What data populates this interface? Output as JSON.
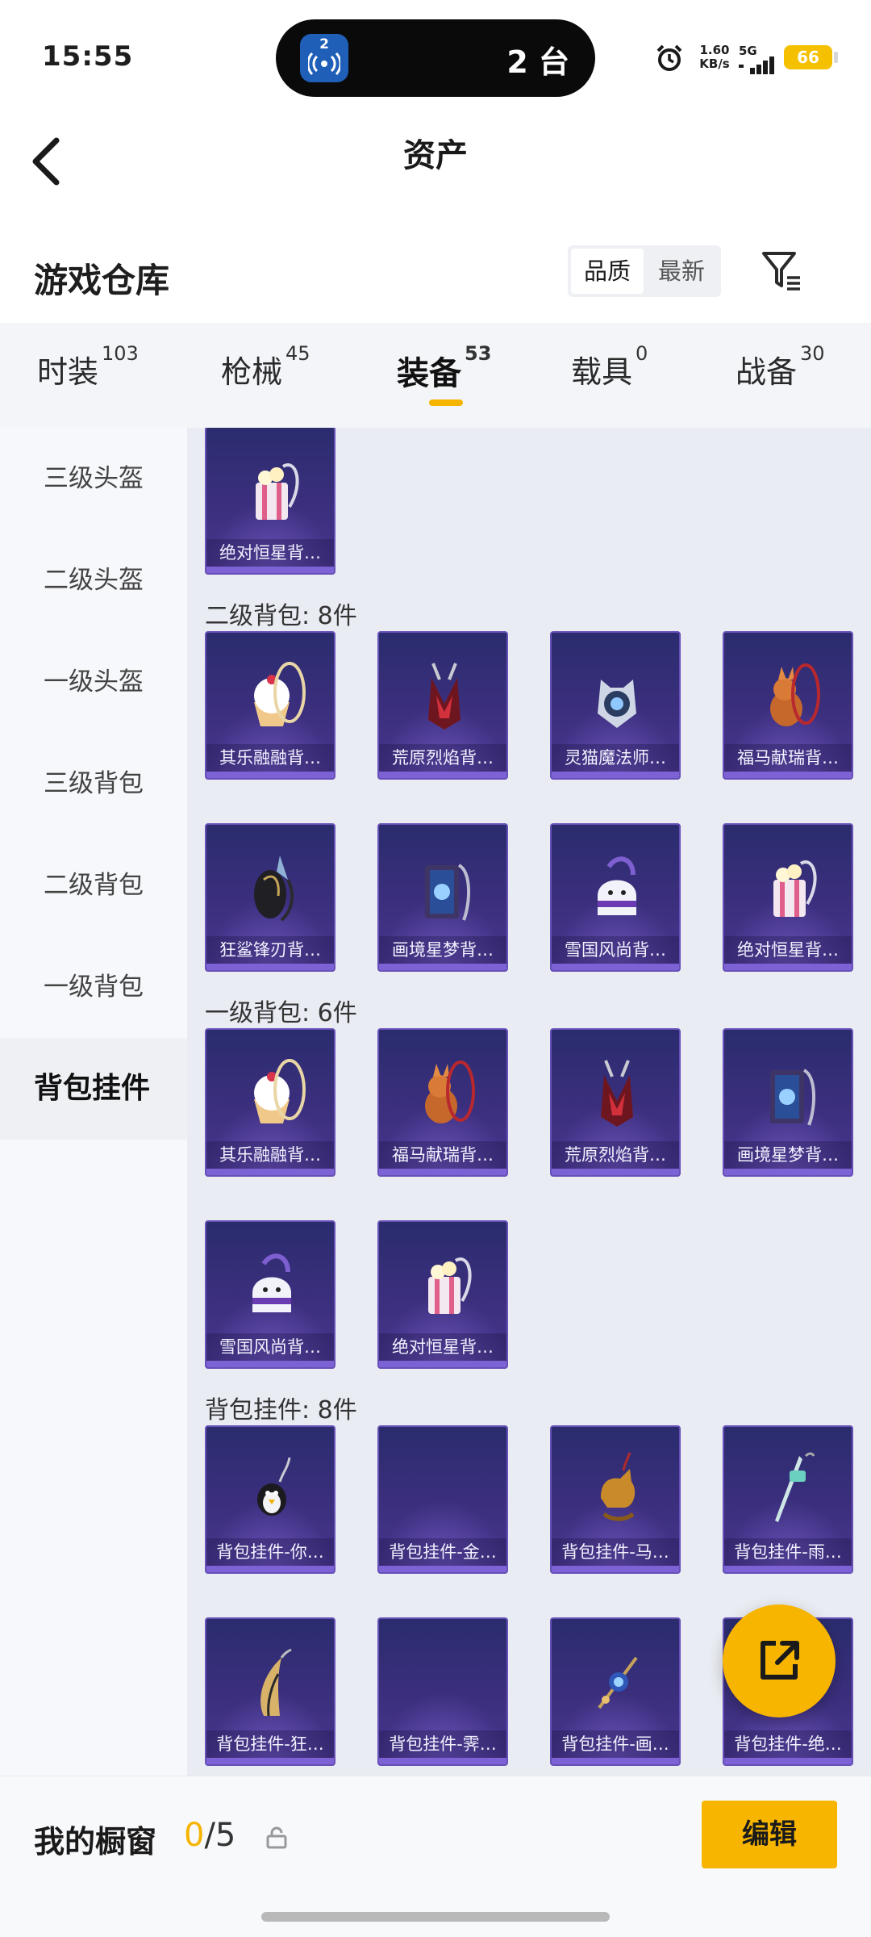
{
  "status": {
    "time": "15:55",
    "island_badge": "2",
    "island_text": "2 台",
    "net_speed_value": "1.60",
    "net_speed_unit": "KB/s",
    "network": "5G",
    "battery": "66"
  },
  "header": {
    "title": "资产"
  },
  "warehouse": {
    "title": "游戏仓库",
    "sort_options": [
      "品质",
      "最新"
    ],
    "selected_sort": "品质"
  },
  "tabs": [
    {
      "label": "时装",
      "count": "103"
    },
    {
      "label": "枪械",
      "count": "45"
    },
    {
      "label": "装备",
      "count": "53",
      "active": true
    },
    {
      "label": "载具",
      "count": "0"
    },
    {
      "label": "战备",
      "count": "30"
    }
  ],
  "categories": [
    {
      "label": "三级头盔"
    },
    {
      "label": "二级头盔"
    },
    {
      "label": "一级头盔"
    },
    {
      "label": "三级背包"
    },
    {
      "label": "二级背包"
    },
    {
      "label": "一级背包"
    },
    {
      "label": "背包挂件",
      "active": true
    }
  ],
  "sections": [
    {
      "title": "",
      "items": [
        {
          "label": "绝对恒星背…",
          "icon": "popcorn-backpack-icon"
        }
      ]
    },
    {
      "title": "二级背包: 8件",
      "items": [
        {
          "label": "其乐融融背…",
          "icon": "cupcake-backpack-icon"
        },
        {
          "label": "荒原烈焰背…",
          "icon": "flame-backpack-icon"
        },
        {
          "label": "灵猫魔法师…",
          "icon": "cat-mage-backpack-icon"
        },
        {
          "label": "福马献瑞背…",
          "icon": "horse-backpack-icon"
        },
        {
          "label": "狂鲨锋刃背…",
          "icon": "shark-backpack-icon"
        },
        {
          "label": "画境星梦背…",
          "icon": "book-backpack-icon"
        },
        {
          "label": "雪国风尚背…",
          "icon": "snowman-backpack-icon"
        },
        {
          "label": "绝对恒星背…",
          "icon": "popcorn-backpack-icon"
        }
      ]
    },
    {
      "title": "一级背包: 6件",
      "items": [
        {
          "label": "其乐融融背…",
          "icon": "cupcake-backpack-icon"
        },
        {
          "label": "福马献瑞背…",
          "icon": "horse-backpack-icon"
        },
        {
          "label": "荒原烈焰背…",
          "icon": "flame-backpack-icon"
        },
        {
          "label": "画境星梦背…",
          "icon": "book-backpack-icon"
        },
        {
          "label": "雪国风尚背…",
          "icon": "snowman-backpack-icon"
        },
        {
          "label": "绝对恒星背…",
          "icon": "popcorn-backpack-icon"
        }
      ]
    },
    {
      "title": "背包挂件: 8件",
      "items": [
        {
          "label": "背包挂件-你…",
          "icon": "penguin-charm-icon"
        },
        {
          "label": "背包挂件-金…",
          "icon": ""
        },
        {
          "label": "背包挂件-马…",
          "icon": "horse-charm-icon"
        },
        {
          "label": "背包挂件-雨…",
          "icon": "sword-charm-icon"
        },
        {
          "label": "背包挂件-狂…",
          "icon": "fin-charm-icon"
        },
        {
          "label": "背包挂件-霁…",
          "icon": ""
        },
        {
          "label": "背包挂件-画…",
          "icon": "gem-charm-icon"
        },
        {
          "label": "背包挂件-绝…",
          "icon": "popcorn-charm-icon"
        }
      ]
    }
  ],
  "showcase": {
    "label": "我的橱窗",
    "current": "0",
    "total": "/5",
    "edit_label": "编辑"
  },
  "colors": {
    "accent": "#f7b500",
    "card_top": "#2a2c6e",
    "card_bottom": "#4a3790",
    "card_border": "#6750b8"
  }
}
